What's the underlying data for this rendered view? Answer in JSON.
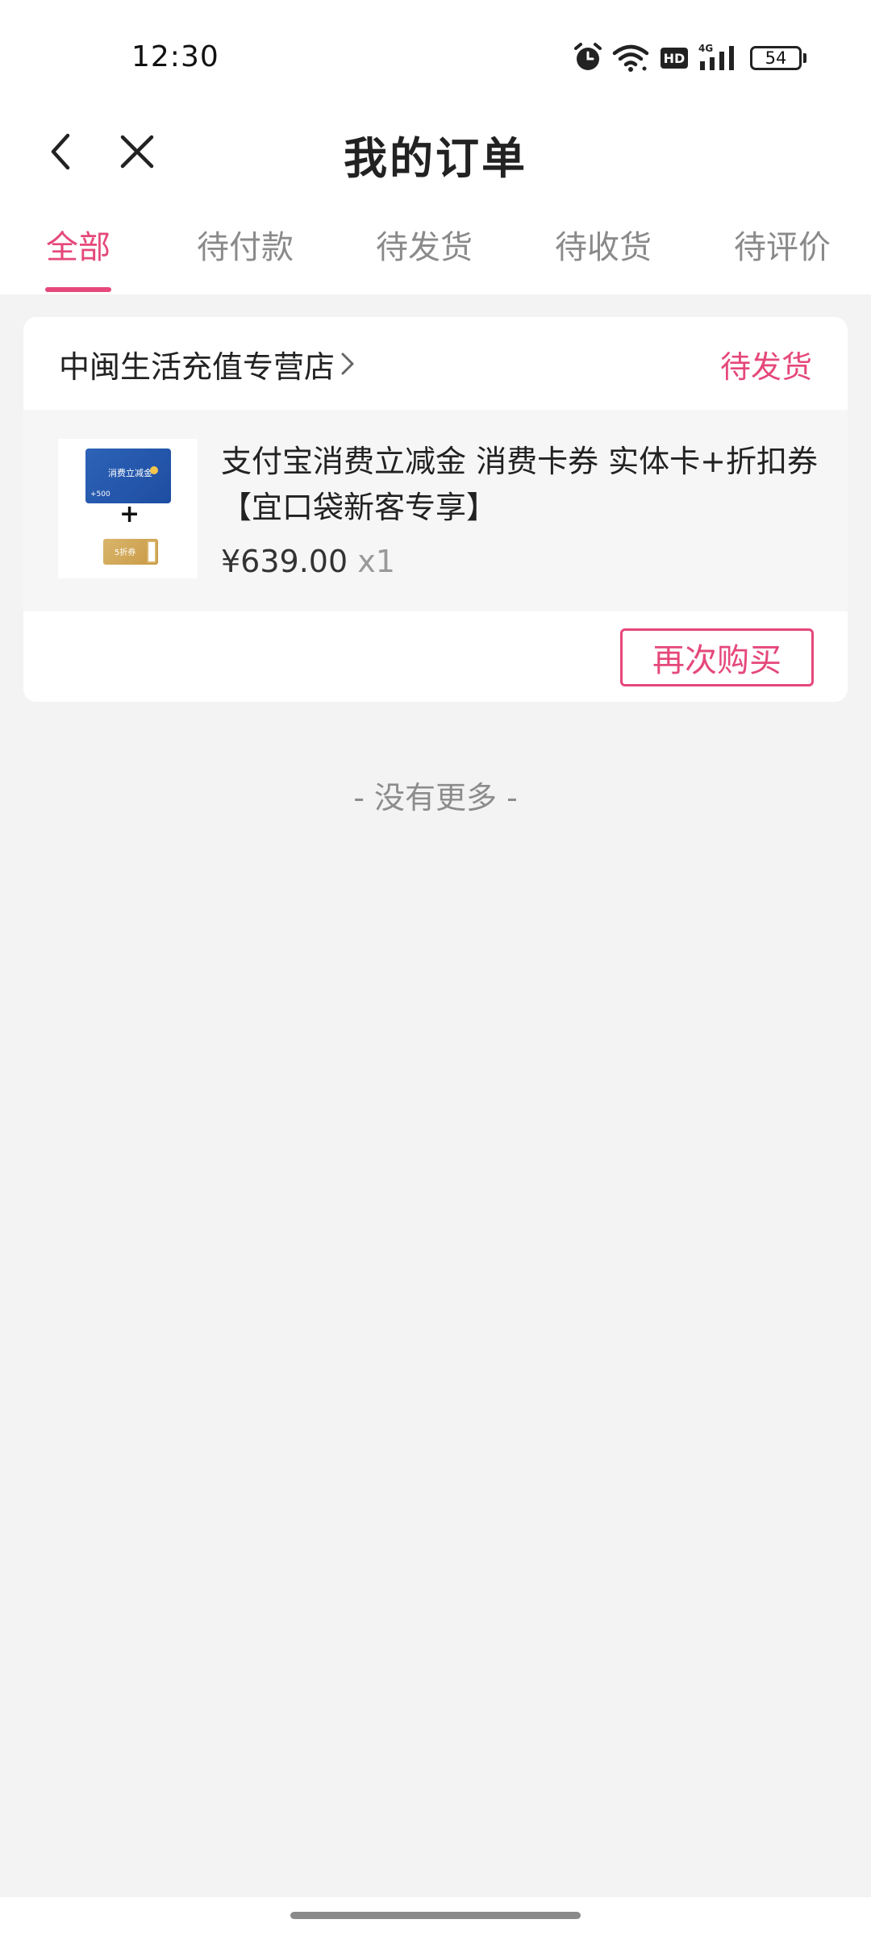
{
  "status_bar": {
    "time": "12:30",
    "battery": "54",
    "network": "4G",
    "hd_label": "HD",
    "icons": [
      "alarm-icon",
      "wifi-icon",
      "hd-icon",
      "signal-icon",
      "battery-icon"
    ]
  },
  "header": {
    "title": "我的订单",
    "back_icon": "chevron-left-icon",
    "close_icon": "close-icon"
  },
  "tabs": [
    {
      "label": "全部",
      "active": true
    },
    {
      "label": "待付款",
      "active": false
    },
    {
      "label": "待发货",
      "active": false
    },
    {
      "label": "待收货",
      "active": false
    },
    {
      "label": "待评价",
      "active": false
    }
  ],
  "order": {
    "store_name": "中闽生活充值专营店",
    "status": "待发货",
    "product": {
      "title": "支付宝消费立减金 消费卡券 实体卡+折扣券【宜口袋新客专享】",
      "price": "¥639.00",
      "quantity": "x1",
      "thumbnail": {
        "card_text": "消费立减金",
        "card_amount": "+500",
        "plus": "+",
        "coupon_text": "5折券"
      }
    },
    "buy_again_label": "再次购买"
  },
  "footer_text": "- 没有更多 -",
  "colors": {
    "accent": "#e5487a",
    "background": "#f3f3f3",
    "muted": "#8a8a8a"
  }
}
